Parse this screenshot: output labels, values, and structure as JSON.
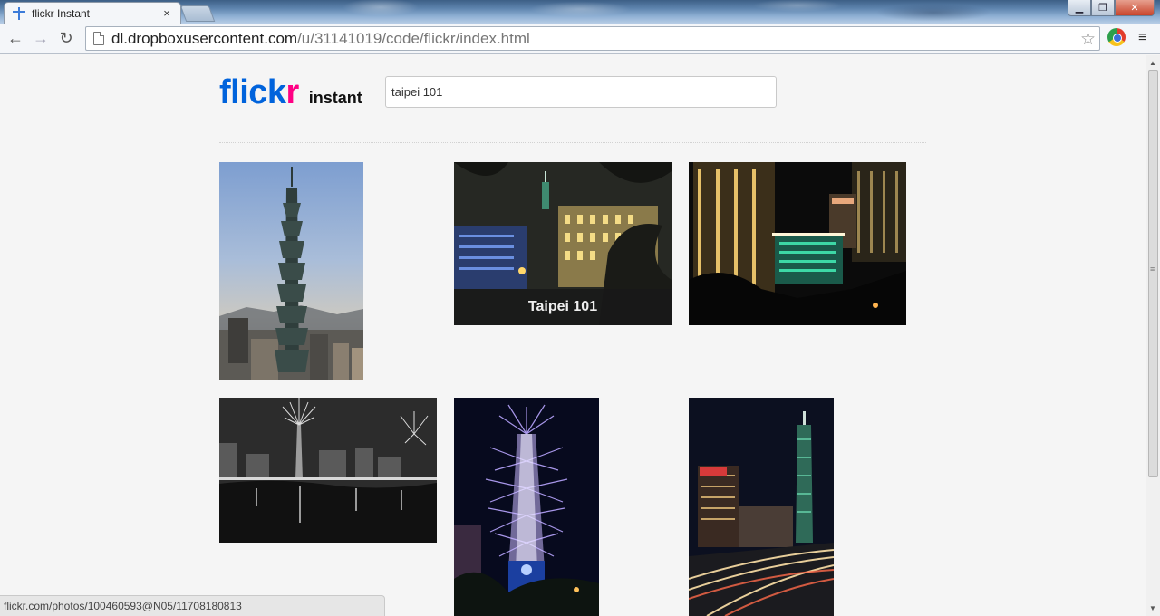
{
  "browser": {
    "tab_title": "flickr Instant",
    "tab_close": "×",
    "url_host": "dl.dropboxusercontent.com",
    "url_path": "/u/31141019/code/flickr/index.html",
    "status_url": "flickr.com/photos/100460593@N05/11708180813",
    "icons": [
      "back-icon",
      "forward-icon",
      "reload-icon",
      "page-icon",
      "bookmark-star-icon",
      "extension-icon",
      "menu-icon"
    ]
  },
  "page": {
    "logo_flick": "flick",
    "logo_r": "r",
    "logo_instant": "instant",
    "search_value": "taipei 101",
    "brand_colors": {
      "blue": "#0063dc",
      "pink": "#ff0084"
    }
  },
  "photos": [
    {
      "caption": ""
    },
    {
      "caption": "Taipei 101"
    },
    {
      "caption": ""
    },
    {
      "caption": ""
    },
    {
      "caption": ""
    },
    {
      "caption": ""
    }
  ]
}
